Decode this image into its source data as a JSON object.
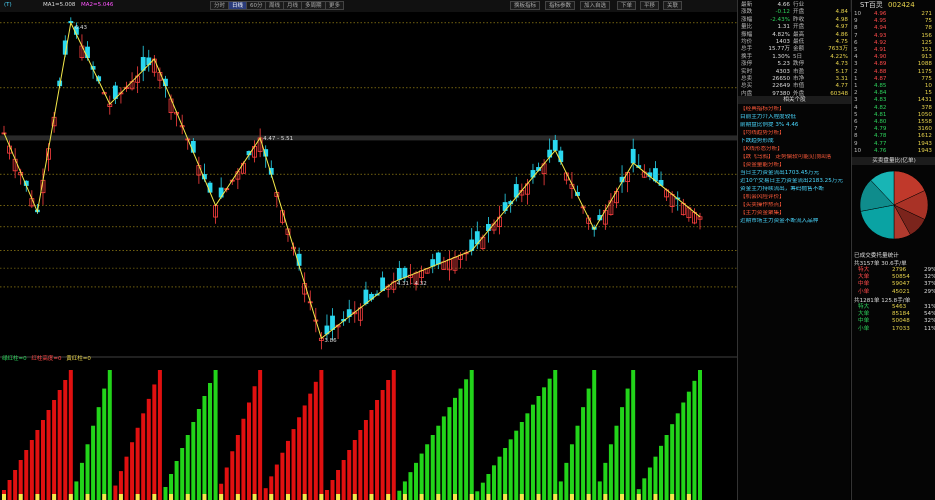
{
  "toolbar": {
    "left_tag": "(T)",
    "ma_tag": "MA1=5.008",
    "ma2_tag": "MA2=5.046",
    "buttons": [
      "分时",
      "日线",
      "60分",
      "周线",
      "月线",
      "多周期",
      "更多"
    ],
    "right_buttons": [
      "换板指标",
      "指标参数",
      "加入自选",
      "下单",
      "平移",
      "关联"
    ]
  },
  "stock": {
    "name": "ST百灵",
    "code": "002424"
  },
  "annotations": [
    {
      "text": "6.43"
    },
    {
      "text": "4.47 - 5.51"
    },
    {
      "text": "4.31 - 4.32"
    },
    {
      "text": "3.86"
    }
  ],
  "sub_legend": [
    "绿红柱=0",
    "红柱高度=0",
    "黄红柱=0"
  ],
  "chart_data": {
    "type": "candlestick",
    "ylim": [
      3.8,
      6.5
    ],
    "zigzag": [
      {
        "i": 0,
        "p": 5.55
      },
      {
        "i": 6,
        "p": 4.92
      },
      {
        "i": 12,
        "p": 6.43
      },
      {
        "i": 19,
        "p": 5.78
      },
      {
        "i": 27,
        "p": 6.14
      },
      {
        "i": 38,
        "p": 4.97
      },
      {
        "i": 46,
        "p": 5.51
      },
      {
        "i": 57,
        "p": 3.91
      },
      {
        "i": 70,
        "p": 4.36
      },
      {
        "i": 84,
        "p": 4.61
      },
      {
        "i": 99,
        "p": 5.41
      },
      {
        "i": 106,
        "p": 4.78
      },
      {
        "i": 113,
        "p": 5.31
      },
      {
        "i": 125,
        "p": 4.88
      }
    ],
    "hlines": [
      6.43,
      5.91,
      5.51,
      5.22,
      4.97,
      4.8,
      4.61,
      4.47,
      4.32
    ],
    "candle_count": 126,
    "volume_cycles": [
      {
        "start": 0,
        "end": 12,
        "color": "red"
      },
      {
        "start": 13,
        "end": 19,
        "color": "green"
      },
      {
        "start": 20,
        "end": 28,
        "color": "red"
      },
      {
        "start": 29,
        "end": 38,
        "color": "green"
      },
      {
        "start": 39,
        "end": 46,
        "color": "red"
      },
      {
        "start": 47,
        "end": 57,
        "color": "red"
      },
      {
        "start": 58,
        "end": 70,
        "color": "red"
      },
      {
        "start": 71,
        "end": 84,
        "color": "green"
      },
      {
        "start": 85,
        "end": 99,
        "color": "green"
      },
      {
        "start": 100,
        "end": 106,
        "color": "green"
      },
      {
        "start": 107,
        "end": 113,
        "color": "green"
      },
      {
        "start": 114,
        "end": 125,
        "color": "green"
      }
    ]
  },
  "quote": [
    [
      "最新",
      "4.66",
      "行业",
      ""
    ],
    [
      "涨跌",
      "-0.12",
      "开盘",
      "4.84"
    ],
    [
      "涨幅",
      "-2.43%",
      "昨收",
      "4.98"
    ],
    [
      "量比",
      "1.31",
      "开盘",
      "4.97"
    ],
    [
      "振幅",
      "4.82%",
      "最高",
      "4.86"
    ],
    [
      "均价",
      "1403",
      "最低",
      "4.75"
    ],
    [
      "总手",
      "15.77万",
      "金额",
      "7633万"
    ],
    [
      "换手",
      "1.30%",
      "5日",
      "4.22%"
    ],
    [
      "涨停",
      "5.23",
      "跌停",
      "4.73"
    ],
    [
      "实时",
      "4303",
      "市盈",
      "5.17"
    ],
    [
      "总卖",
      "26650",
      "市净",
      "3.31"
    ],
    [
      "总买",
      "22649",
      "市值",
      "4.77"
    ],
    [
      "内盘",
      "97380",
      "外盘",
      "60348"
    ]
  ],
  "news_title": "相关个股",
  "news": [
    "【经典指标分析】",
    "目前主力介入程度较低",
    "前期盘比例提 3% 4.46",
    "【均线趋势分析】",
    "下跌趋势形成",
    "【K线形态分析】",
    "【跌飞乌鸦】 走势偏软可能见顶回落",
    "【资金量能分析】",
    "当日主力资金流出1703.45万元",
    "近10个交易日主力资金流出2183.25万元",
    "资金主力持续流出，筹码抛售不断",
    "【机会风险评价】",
    "【买卖操作热点】",
    "【主力资金聚集】",
    "近期市场主力资金不断流入品种"
  ],
  "orderbook": [
    [
      "10",
      "4.96",
      "271"
    ],
    [
      "9",
      "4.95",
      "75"
    ],
    [
      "8",
      "4.94",
      "78"
    ],
    [
      "7",
      "4.93",
      "156"
    ],
    [
      "6",
      "4.92",
      "125"
    ],
    [
      "5",
      "4.91",
      "151"
    ],
    [
      "4",
      "4.90",
      "913"
    ],
    [
      "3",
      "4.89",
      "1088"
    ],
    [
      "2",
      "4.88",
      "1175"
    ],
    [
      "1",
      "4.87",
      "775"
    ],
    [
      "1",
      "4.85",
      "10"
    ],
    [
      "2",
      "4.84",
      "15"
    ],
    [
      "3",
      "4.83",
      "1431"
    ],
    [
      "4",
      "4.82",
      "378"
    ],
    [
      "5",
      "4.81",
      "1050"
    ],
    [
      "6",
      "4.80",
      "1558"
    ],
    [
      "7",
      "4.79",
      "3160"
    ],
    [
      "8",
      "4.78",
      "1612"
    ],
    [
      "9",
      "4.77",
      "1943"
    ],
    [
      "10",
      "4.76",
      "1943"
    ]
  ],
  "pie_title": "买卖盘量比(亿单)",
  "pie": [
    {
      "color": "#c0392b",
      "v": 18
    },
    {
      "color": "#a93226",
      "v": 14
    },
    {
      "color": "#7b241c",
      "v": 10
    },
    {
      "color": "#b03a2e",
      "v": 8
    },
    {
      "color": "#0aa3a3",
      "v": 22
    },
    {
      "color": "#0f8c8c",
      "v": 16
    },
    {
      "color": "#18b5b5",
      "v": 12
    }
  ],
  "summary_title": "已成交委托量统计",
  "summary1": "共3157单 30.6手/单",
  "rows1": [
    [
      "特大",
      "2796",
      "29%"
    ],
    [
      "大单",
      "50854",
      "32%"
    ],
    [
      "中单",
      "59047",
      "37%"
    ],
    [
      "小单",
      "45021",
      "29%"
    ]
  ],
  "summary2": "共1281单 125.8手/单",
  "rows2": [
    [
      "特大",
      "5463",
      "31%"
    ],
    [
      "大单",
      "85184",
      "54%"
    ],
    [
      "中单",
      "50048",
      "32%"
    ],
    [
      "小单",
      "17033",
      "11%"
    ]
  ]
}
